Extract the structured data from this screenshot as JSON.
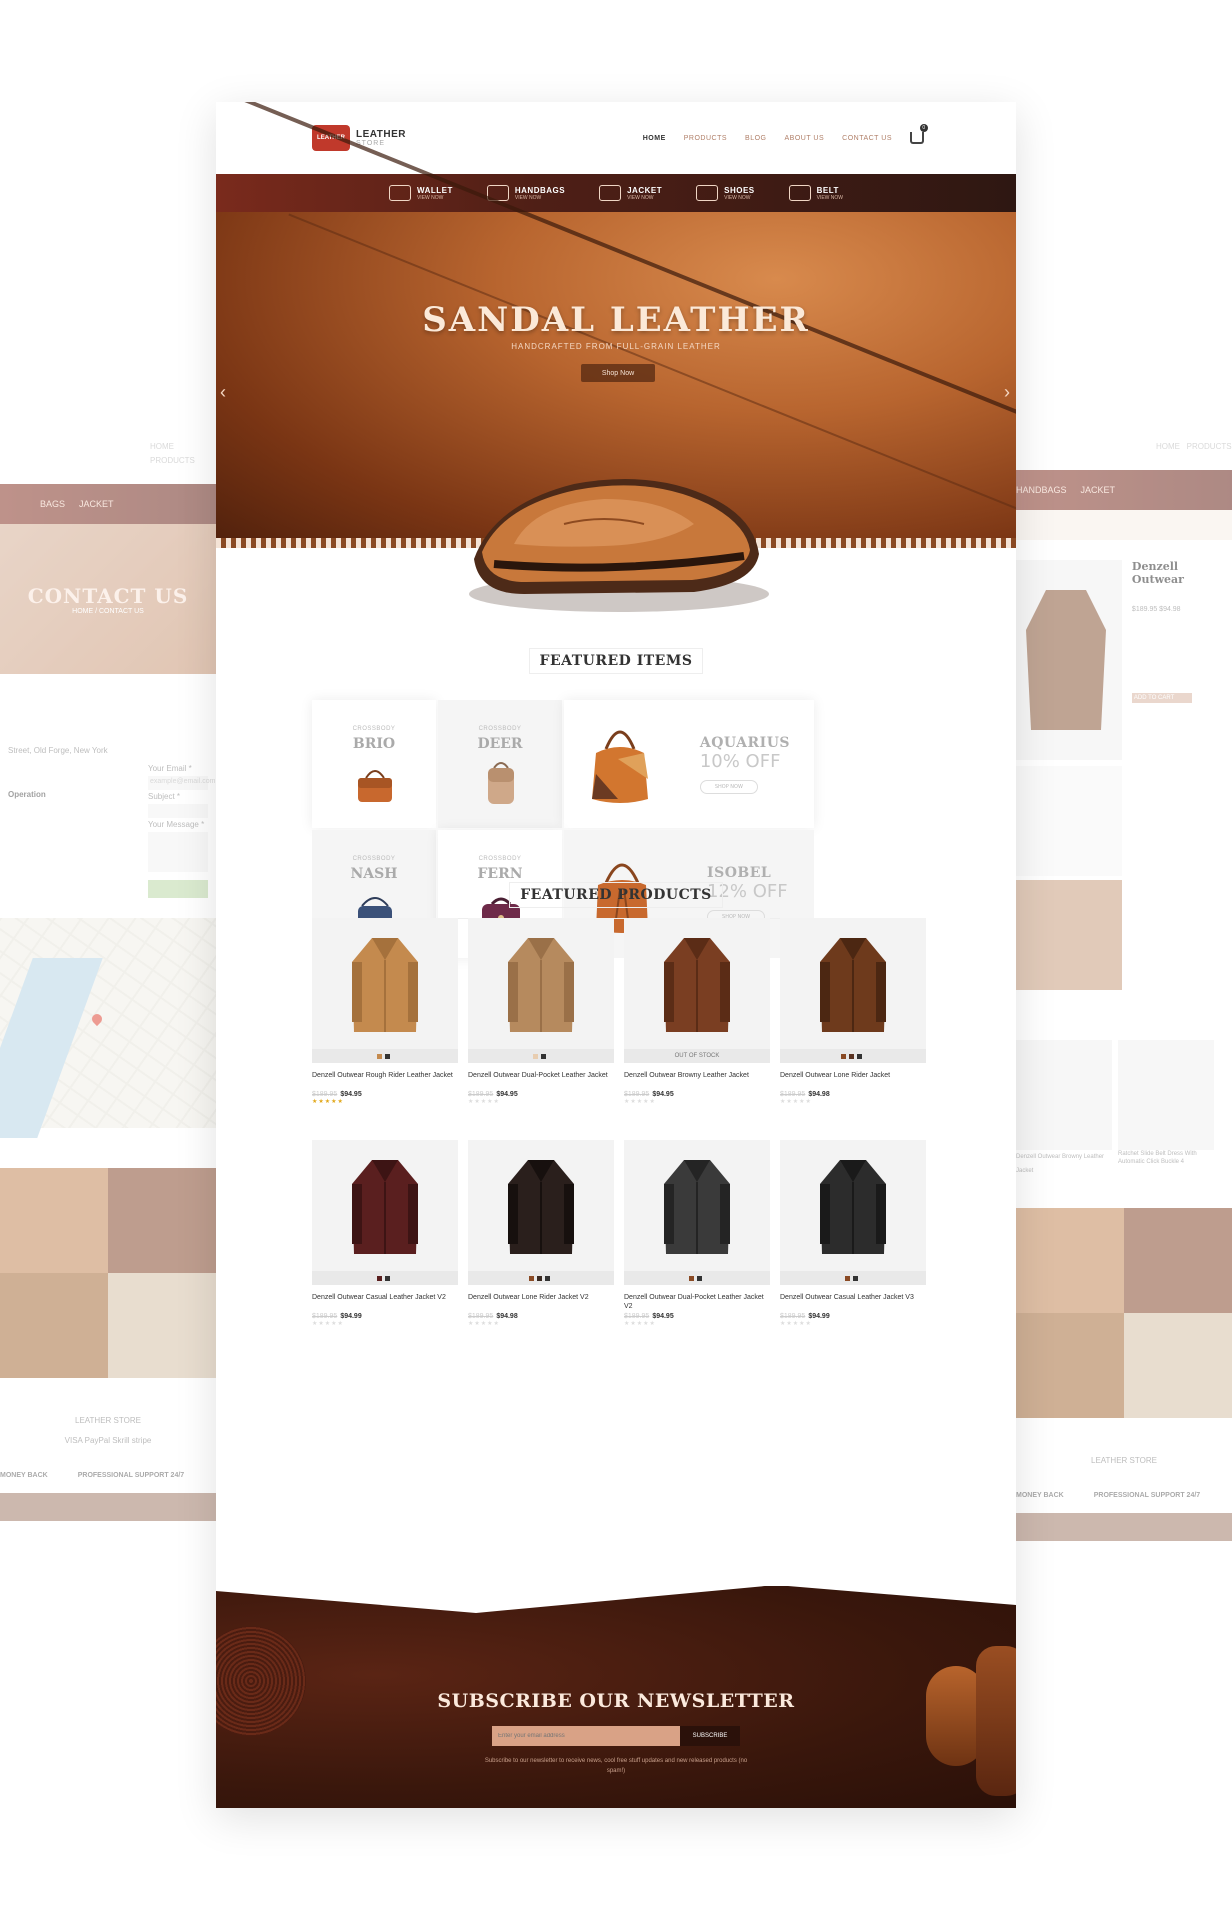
{
  "header": {
    "logo_badge": "LEATHER",
    "logo_title": "LEATHER",
    "logo_sub": "STORE",
    "nav": [
      "HOME",
      "PRODUCTS",
      "BLOG",
      "ABOUT US",
      "CONTACT US"
    ],
    "cart_count": "0"
  },
  "categories": [
    {
      "label": "WALLET",
      "sub": "VIEW NOW"
    },
    {
      "label": "HANDBAGS",
      "sub": "VIEW NOW"
    },
    {
      "label": "JACKET",
      "sub": "VIEW NOW"
    },
    {
      "label": "SHOES",
      "sub": "VIEW NOW"
    },
    {
      "label": "BELT",
      "sub": "VIEW NOW"
    }
  ],
  "hero": {
    "title": "SANDAL LEATHER",
    "subtitle": "HANDCRAFTED FROM FULL-GRAIN LEATHER",
    "button": "Shop Now"
  },
  "featured_items": {
    "title": "FEATURED ITEMS",
    "small": [
      {
        "tag": "CROSSBODY",
        "name": "BRIO"
      },
      {
        "tag": "CROSSBODY",
        "name": "DEER"
      },
      {
        "tag": "CROSSBODY",
        "name": "NASH"
      },
      {
        "tag": "CROSSBODY",
        "name": "FERN"
      }
    ],
    "big": [
      {
        "name": "AQUARIUS",
        "offer": "10% OFF",
        "button": "SHOP NOW"
      },
      {
        "name": "ISOBEL",
        "offer": "12% OFF",
        "button": "SHOP NOW"
      }
    ]
  },
  "featured_products": {
    "title": "FEATURED PRODUCTS",
    "items": [
      {
        "name": "Denzell Outwear Rough Rider Leather Jacket",
        "old": "$189.95",
        "price": "$94.95",
        "stock": "",
        "stars": "★★★★★",
        "rated": true
      },
      {
        "name": "Denzell Outwear Dual-Pocket Leather Jacket",
        "old": "$189.95",
        "price": "$94.95",
        "stock": "",
        "stars": "★★★★★",
        "rated": false
      },
      {
        "name": "Denzell Outwear Browny Leather Jacket",
        "old": "$189.95",
        "price": "$94.95",
        "stock": "OUT OF STOCK",
        "stars": "★★★★★",
        "rated": false
      },
      {
        "name": "Denzell Outwear Lone Rider Jacket",
        "old": "$189.95",
        "price": "$94.98",
        "stock": "",
        "stars": "★★★★★",
        "rated": false
      },
      {
        "name": "Denzell Outwear Casual Leather Jacket V2",
        "old": "$189.95",
        "price": "$94.99",
        "stock": "",
        "stars": "★★★★★",
        "rated": false
      },
      {
        "name": "Denzell Outwear Lone Rider Jacket V2",
        "old": "$189.95",
        "price": "$94.98",
        "stock": "",
        "stars": "★★★★★",
        "rated": false
      },
      {
        "name": "Denzell Outwear Dual-Pocket Leather Jacket V2",
        "old": "$189.95",
        "price": "$94.95",
        "stock": "",
        "stars": "★★★★★",
        "rated": false
      },
      {
        "name": "Denzell Outwear Casual Leather Jacket V3",
        "old": "$189.95",
        "price": "$94.99",
        "stock": "",
        "stars": "★★★★★",
        "rated": false
      }
    ]
  },
  "newsletter": {
    "title": "SUBSCRIBE OUR NEWSLETTER",
    "placeholder": "Enter your email address",
    "button": "SUBSCRIBE",
    "note": "Subscribe to our newsletter to receive news, cool free stuff updates and new released products (no spam!)"
  },
  "side_left": {
    "nav": [
      "HOME",
      "PRODUCTS"
    ],
    "cats": [
      "BAGS",
      "JACKET"
    ],
    "hero_title": "CONTACT US",
    "hero_sub": "HOME / CONTACT US",
    "address": "Street, Old Forge, New York",
    "operation": "Operation",
    "fields": [
      "Your Email *",
      "Subject *",
      "Your Message *"
    ],
    "email_placeholder": "example@email.com",
    "store": "LEATHER STORE",
    "pay": "VISA  PayPal  Skrill  stripe",
    "money_back": "MONEY BACK",
    "support": "PROFESSIONAL SUPPORT 24/7"
  },
  "side_right": {
    "nav": [
      "HOME",
      "PRODUCTS"
    ],
    "cats": [
      "HANDBAGS",
      "JACKET"
    ],
    "product_title": "Denzell Outwear",
    "price": "$189.95 $94.98",
    "add_to_cart": "ADD TO CART",
    "related": [
      "Denzell Outwear Browny Leather Jacket",
      "Ratchet Slide Belt Dress With Automatic Click Buckle 4"
    ],
    "store": "LEATHER STORE",
    "money_back": "MONEY BACK",
    "support": "PROFESSIONAL SUPPORT 24/7"
  },
  "colors": {
    "brand": "#7a2a1c",
    "accent": "#c0392b",
    "rating": "#e2a81a"
  }
}
